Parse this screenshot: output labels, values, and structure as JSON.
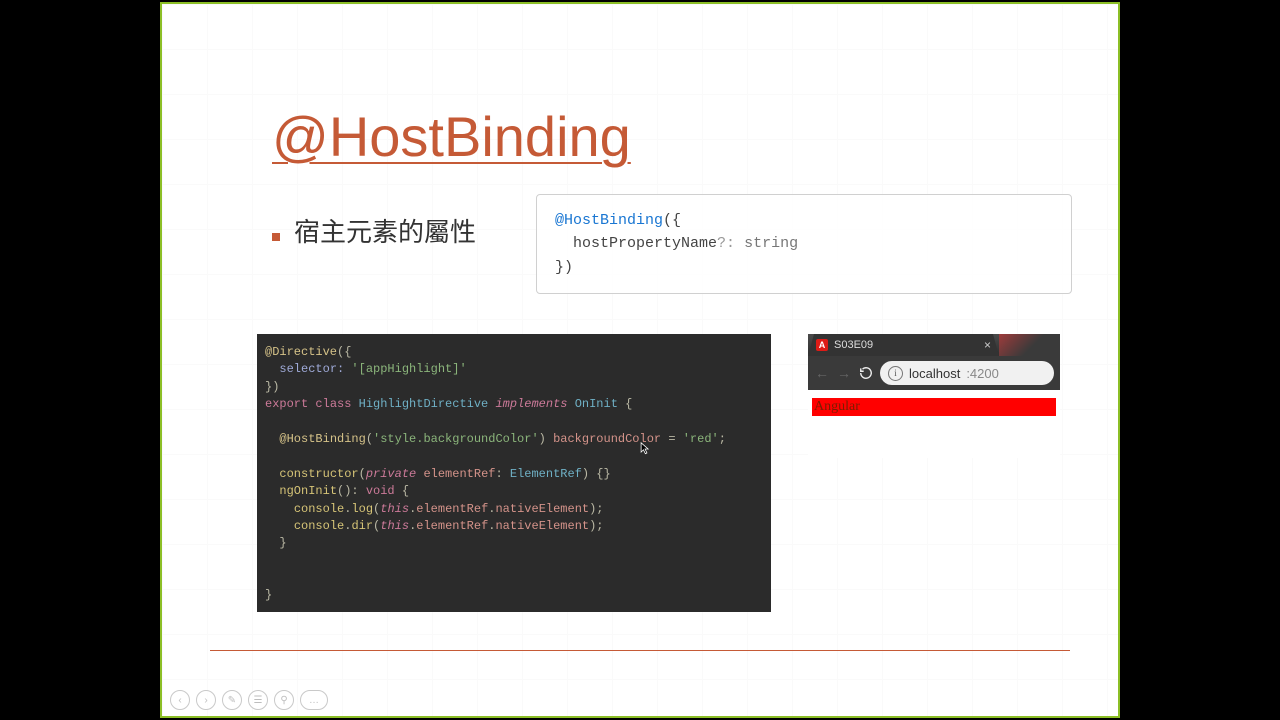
{
  "title": "@HostBinding",
  "bullet": "宿主元素的屬性",
  "signature": {
    "decorator": "@HostBinding",
    "open": "({",
    "param_name": "hostPropertyName",
    "opt_marker": "?:",
    "param_type": "string",
    "close": "})"
  },
  "code": {
    "decorator_directive": "@Directive",
    "directive_open": "({",
    "selector_key": "selector:",
    "selector_value": "'[appHighlight]'",
    "directive_close": "})",
    "export": "export",
    "class_kw": "class",
    "class_name": "HighlightDirective",
    "implements": "implements",
    "interface": "OnInit",
    "brace_open": "{",
    "hostbinding_dec": "@HostBinding",
    "hostbinding_arg": "'style.backgroundColor'",
    "prop_name": "backgroundColor",
    "equals": "=",
    "prop_value": "'red'",
    "semicolon": ";",
    "constructor": "constructor",
    "private": "private",
    "param_ident": "elementRef",
    "param_type": "ElementRef",
    "ctor_body": "{}",
    "ngOnInit": "ngOnInit",
    "void": "void",
    "console_log": "console",
    "log_fn": "log",
    "dir_fn": "dir",
    "this": "this",
    "elementRef": "elementRef",
    "nativeElement": "nativeElement",
    "brace_close": "}"
  },
  "browser": {
    "tab_title": "S03E09",
    "favicon_letter": "A",
    "close_glyph": "×",
    "url_host": "localhost",
    "url_port": ":4200",
    "info_glyph": "i",
    "page_text": "Angular"
  },
  "controls": {
    "prev": "‹",
    "next": "›",
    "pen": "✎",
    "caption": "☰",
    "zoom": "⚲",
    "more": "…"
  }
}
